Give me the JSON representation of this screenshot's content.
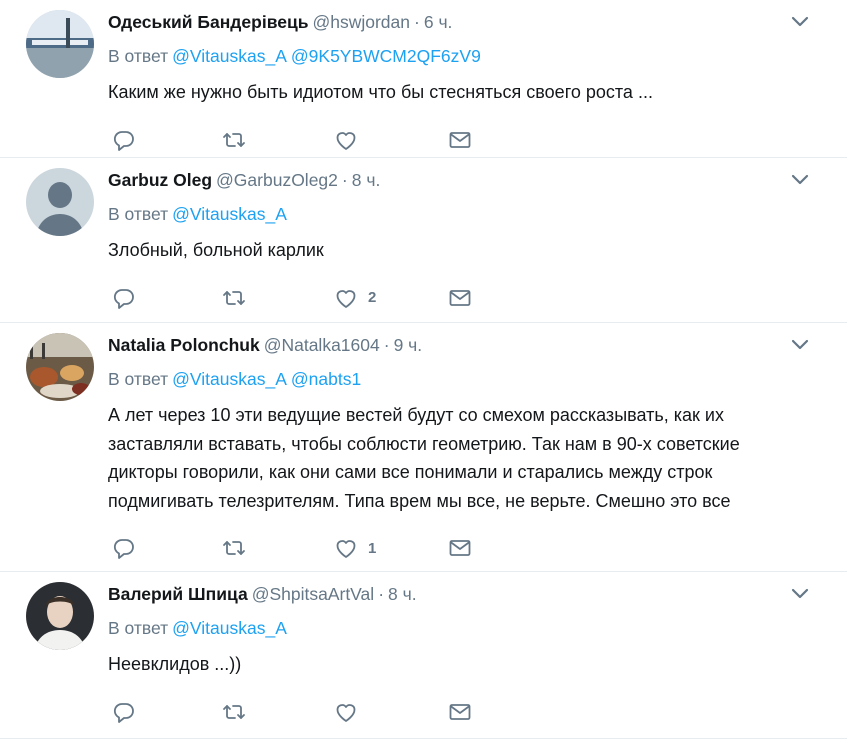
{
  "colors": {
    "link": "#1da1f2",
    "secondary_text": "#657786",
    "divider": "#e6ecf0",
    "icon": "#657786"
  },
  "tweets": [
    {
      "fullname": "Одеський Бандерівець",
      "username": "@hswjordan",
      "time": "6 ч.",
      "reply_prefix": "В ответ",
      "mentions": [
        "@Vitauskas_A",
        "@9K5YBWCM2QF6zV9"
      ],
      "text": "Каким  же нужно быть идиотом что бы стесняться своего роста ...",
      "likes": ""
    },
    {
      "fullname": "Garbuz Oleg",
      "username": "@GarbuzOleg2",
      "time": "8 ч.",
      "reply_prefix": "В ответ",
      "mentions": [
        "@Vitauskas_A"
      ],
      "text": "Злобный, больной карлик",
      "likes": "2"
    },
    {
      "fullname": "Natalia Polonchuk",
      "username": "@Natalka1604",
      "time": "9 ч.",
      "reply_prefix": "В ответ",
      "mentions": [
        "@Vitauskas_A",
        "@nabts1"
      ],
      "text": "А лет через 10 эти ведущие вестей будут со смехом рассказывать, как их\nзаставляли вставать, чтобы соблюсти геометрию. Так нам в 90-х советские\nдикторы говорили, как они сами все понимали и старались между строк\nподмигивать телезрителям. Типа врем мы все, не верьте. Смешно это все",
      "likes": "1"
    },
    {
      "fullname": "Валерий Шпица",
      "username": "@ShpitsaArtVal",
      "time": "8 ч.",
      "reply_prefix": "В ответ",
      "mentions": [
        "@Vitauskas_A"
      ],
      "text": "Неевклидов ...))",
      "likes": ""
    }
  ],
  "icons": {
    "reply": "reply-icon",
    "retweet": "retweet-icon",
    "like": "heart-icon",
    "dm": "envelope-icon",
    "more": "chevron-down-icon"
  }
}
